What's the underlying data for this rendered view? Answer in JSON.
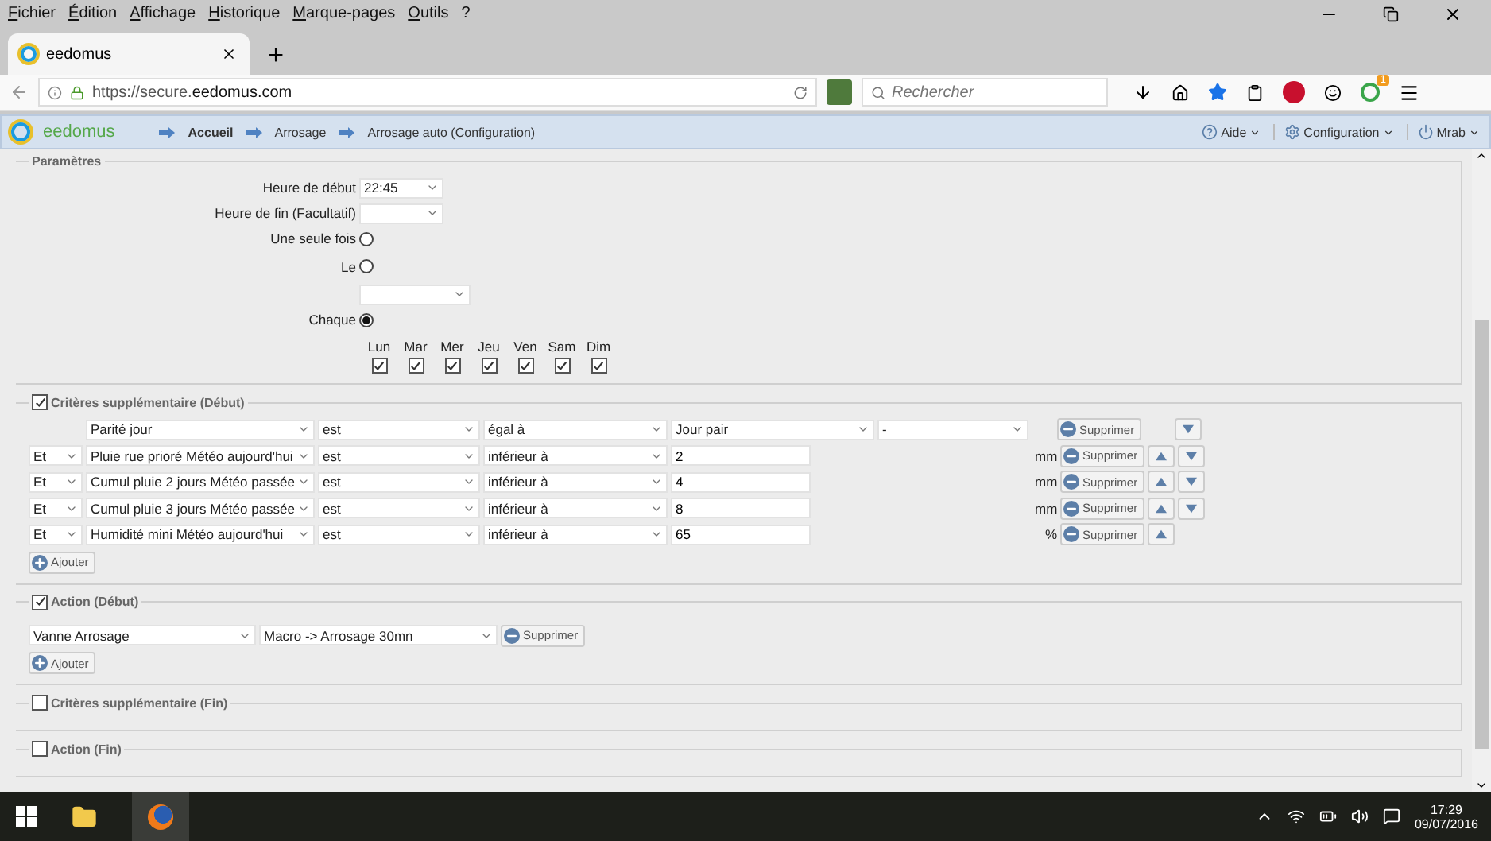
{
  "menu": [
    "Fichier",
    "Édition",
    "Affichage",
    "Historique",
    "Marque-pages",
    "Outils",
    "?"
  ],
  "tab": {
    "title": "eedomus",
    "selected": true
  },
  "address": {
    "url": "https://secure.**eedomus.com**"
  },
  "search": {
    "placeholder": "Rechercher"
  },
  "extension_badge": "1",
  "app_header": {
    "logo": "eedomus",
    "breadcrumb": [
      {
        "label": "Accueil",
        "selected": true
      },
      {
        "label": "Arrosage",
        "selected": false
      },
      {
        "label": "Arrosage auto (Configuration)",
        "selected": false
      }
    ],
    "menus": [
      {
        "kind": "help",
        "label": "Aide"
      },
      {
        "kind": "settings",
        "label": "Configuration"
      },
      {
        "kind": "power",
        "label": "Mrab"
      }
    ]
  },
  "parametres": {
    "legend": "Paramètres",
    "start_time": {
      "label": "Heure de début",
      "value": "22:45"
    },
    "end_time": {
      "label": "Heure de fin (Facultatif)"
    },
    "once": {
      "label": "Une seule fois",
      "selected": false
    },
    "date": {
      "label": "Le",
      "selected": false
    },
    "every": {
      "label": "Chaque",
      "selected": true
    },
    "days": [
      {
        "label": "Lun",
        "checked": true
      },
      {
        "label": "Mar",
        "checked": true
      },
      {
        "label": "Mer",
        "checked": true
      },
      {
        "label": "Jeu",
        "checked": true
      },
      {
        "label": "Ven",
        "checked": true
      },
      {
        "label": "Sam",
        "checked": true
      },
      {
        "label": "Dim",
        "checked": true
      }
    ]
  },
  "criteria_start": {
    "legend": "Critères supplémentaire (Début)",
    "checked": true,
    "add_label": "Ajouter",
    "rows": [
      {
        "kind": "select",
        "field": "Parité jour",
        "operator": "est",
        "comparator": "égal à",
        "value": "Jour pair",
        "extra": "-",
        "delete_label": "Supprimer",
        "move_up": false,
        "move_down": true
      },
      {
        "kind": "input",
        "conjunction": "Et",
        "field": "Pluie rue prioré Météo aujourd'hui",
        "operator": "est",
        "comparator": "inférieur à",
        "value": "2",
        "unit": "mm",
        "delete_label": "Supprimer",
        "move_up": true,
        "move_down": true
      },
      {
        "kind": "input",
        "conjunction": "Et",
        "field": "Cumul pluie 2 jours Météo passée",
        "operator": "est",
        "comparator": "inférieur à",
        "value": "4",
        "unit": "mm",
        "delete_label": "Supprimer",
        "move_up": true,
        "move_down": true
      },
      {
        "kind": "input",
        "conjunction": "Et",
        "field": "Cumul pluie 3 jours Météo passée",
        "operator": "est",
        "comparator": "inférieur à",
        "value": "8",
        "unit": "mm",
        "delete_label": "Supprimer",
        "move_up": true,
        "move_down": true
      },
      {
        "kind": "input",
        "conjunction": "Et",
        "field": "Humidité mini Météo aujourd'hui",
        "operator": "est",
        "comparator": "inférieur à",
        "value": "65",
        "unit": "%",
        "delete_label": "Supprimer",
        "move_up": true,
        "move_down": false
      }
    ]
  },
  "action_start": {
    "legend": "Action (Début)",
    "checked": true,
    "add_label": "Ajouter",
    "rows": [
      {
        "device": "Vanne Arrosage",
        "action": "Macro -> Arrosage 30mn",
        "delete_label": "Supprimer"
      }
    ]
  },
  "criteria_end": {
    "legend": "Critères supplémentaire (Fin)",
    "checked": false
  },
  "action_end": {
    "legend": "Action (Fin)",
    "checked": false
  },
  "taskbar": {
    "time": "17:29",
    "date": "09/07/2016"
  }
}
